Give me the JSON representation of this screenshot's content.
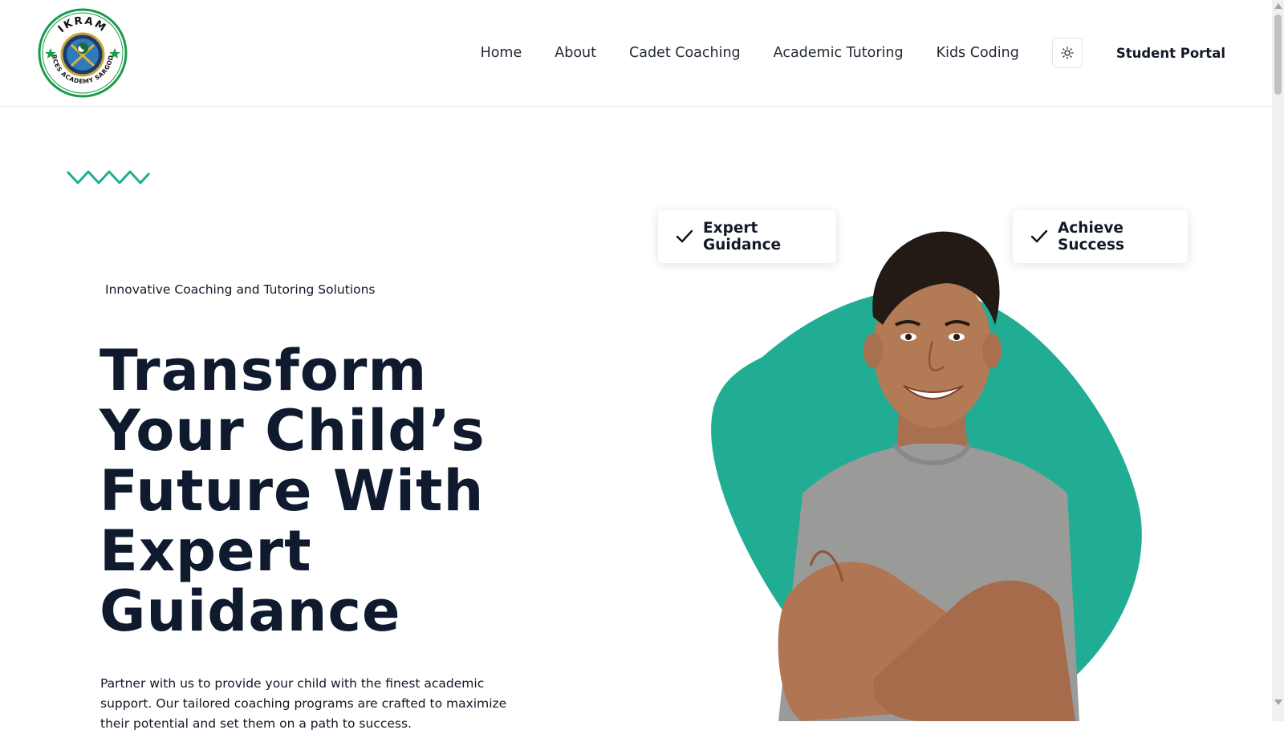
{
  "header": {
    "logo": {
      "top_text": "IKRAM",
      "ring_text": "FORCES ACADEMY SARGODHA",
      "icon": "academy-emblem-icon"
    },
    "nav": [
      {
        "label": "Home"
      },
      {
        "label": "About"
      },
      {
        "label": "Cadet Coaching"
      },
      {
        "label": "Academic Tutoring"
      },
      {
        "label": "Kids Coding"
      }
    ],
    "theme_toggle_icon": "sun-icon",
    "portal_label": "Student Portal"
  },
  "hero": {
    "tagline": "Innovative Coaching and Tutoring Solutions",
    "headline_lines": [
      "Transform",
      "Your Child’s",
      "Future With",
      "Expert",
      "Guidance"
    ],
    "intro": "Partner with us to provide your child with the finest academic support. Our tailored coaching programs are crafted to maximize their potential and set them on a path to success.",
    "features": [
      {
        "label": "Expert Guidance",
        "icon": "check-icon"
      },
      {
        "label": "Achieve Success",
        "icon": "check-icon"
      }
    ]
  },
  "colors": {
    "accent": "#20ad94",
    "text_dark": "#0f1a2e",
    "logo_green": "#1a9a4a",
    "logo_navy": "#1b3a6b"
  }
}
